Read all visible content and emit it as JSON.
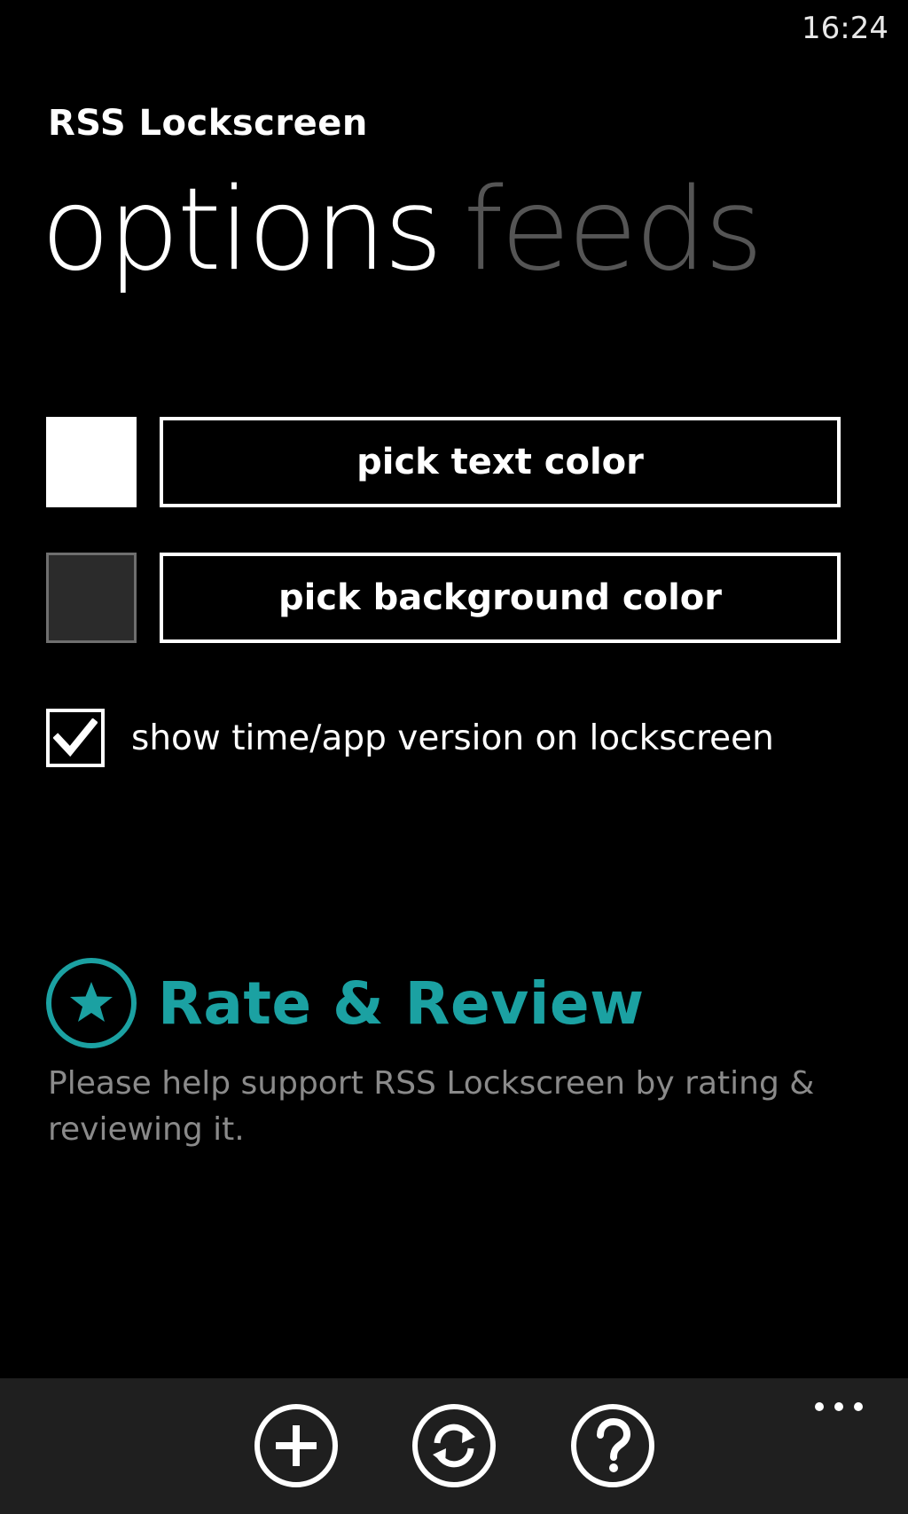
{
  "status_bar": {
    "time": "16:24"
  },
  "app": {
    "title": "RSS Lockscreen"
  },
  "pivot": {
    "tabs": [
      {
        "label": "options",
        "active": true
      },
      {
        "label": "feeds",
        "active": false
      }
    ]
  },
  "options": {
    "text_color": {
      "label": "pick text color",
      "swatch": "#ffffff"
    },
    "background_color": {
      "label": "pick background color",
      "swatch": "#2b2b2b"
    },
    "show_time_checkbox": {
      "label": "show time/app version on lockscreen",
      "checked": true
    }
  },
  "rate": {
    "title": "Rate & Review",
    "description": "Please help support RSS Lockscreen by rating & reviewing it.",
    "accent_color": "#1ba1a2",
    "icon": "star-icon"
  },
  "app_bar": {
    "buttons": [
      {
        "icon": "add-icon"
      },
      {
        "icon": "sync-icon"
      },
      {
        "icon": "help-icon"
      }
    ],
    "more_icon": "more-dots-icon"
  }
}
